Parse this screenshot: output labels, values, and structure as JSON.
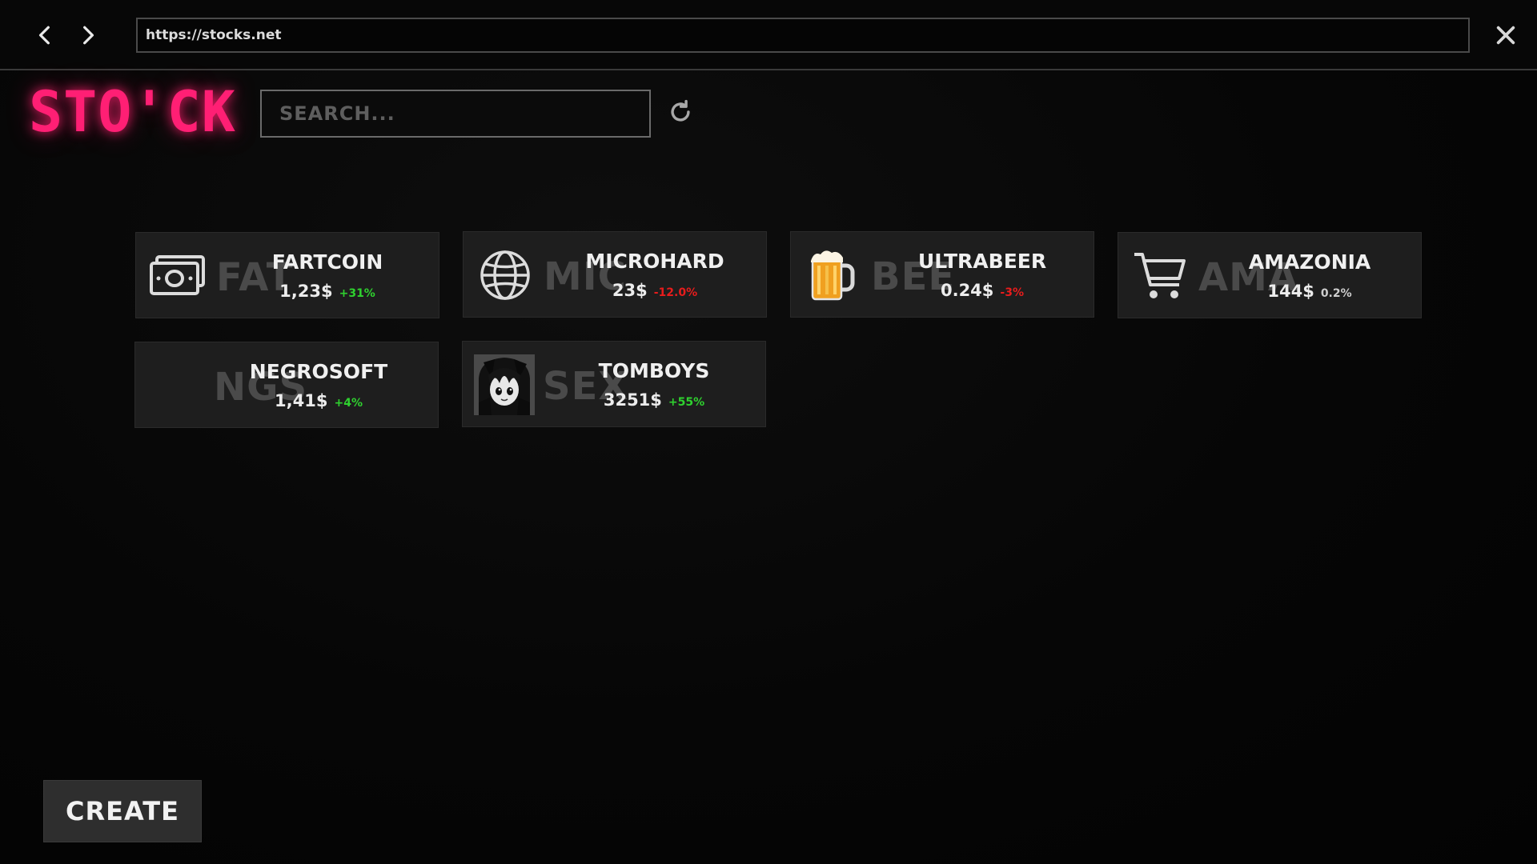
{
  "browser": {
    "url": "https://stocks.net"
  },
  "header": {
    "logo_text": "STO'CK",
    "search_placeholder": "SEARCH...",
    "logo_color": "#ff1f74"
  },
  "stocks": [
    {
      "name": "FARTCOIN",
      "ticker": "FAT",
      "price": "1,23$",
      "change": "+31%",
      "trend": "up",
      "icon": "money-icon"
    },
    {
      "name": "MICROHARD",
      "ticker": "MIC",
      "price": "23$",
      "change": "-12.0%",
      "trend": "down",
      "icon": "globe-icon"
    },
    {
      "name": "ULTRABEER",
      "ticker": "BEE",
      "price": "0.24$",
      "change": "-3%",
      "trend": "down",
      "icon": "beer-mug-icon"
    },
    {
      "name": "AMAZONIA",
      "ticker": "AMA",
      "price": "144$",
      "change": "0.2%",
      "trend": "neutral",
      "icon": "shopping-cart-icon"
    },
    {
      "name": "NEGROSOFT",
      "ticker": "NGS",
      "price": "1,41$",
      "change": "+4%",
      "trend": "up",
      "icon": ""
    },
    {
      "name": "TOMBOYS",
      "ticker": "SEX",
      "price": "3251$",
      "change": "+55%",
      "trend": "up",
      "icon": "anime-portrait-icon"
    }
  ],
  "colors": {
    "up": "#2fd12f",
    "down": "#e81c1c",
    "neutral": "#cfcfcf"
  },
  "footer": {
    "create_label": "CREATE"
  }
}
